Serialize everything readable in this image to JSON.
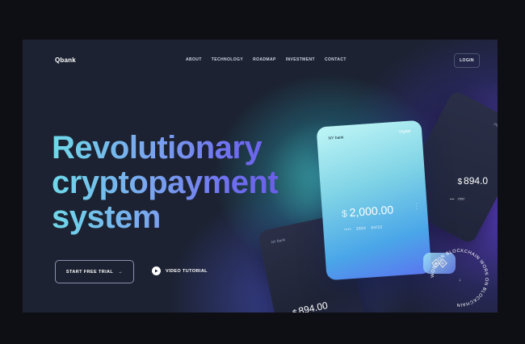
{
  "header": {
    "logo": "Qbank",
    "nav": [
      "ABOUT",
      "TECHNOLOGY",
      "ROADMAP",
      "INVESTMENT",
      "CONTACT"
    ],
    "login_label": "LOGIN"
  },
  "hero": {
    "headline_lines": [
      "Revolutionary",
      "cryptopayment",
      "system"
    ],
    "trial_label": "START FREE TRIAL",
    "trial_arrow": "→",
    "video_label": "VIDEO TUTORIAL"
  },
  "cards": {
    "main": {
      "bank": "NY bank",
      "type": "Digital",
      "currency": "$",
      "amount": "2,000.00",
      "masked": "••••",
      "number": "2552",
      "expiry": "04/22"
    },
    "left": {
      "bank": "NY Bank",
      "currency": "$",
      "amount": "894.00"
    },
    "right": {
      "type": "Physical",
      "currency": "$",
      "amount": "894.0",
      "masked": "••••",
      "number": "2552"
    }
  },
  "badge": {
    "ring_text": "WORK ON BLOCKCHAIN WORK ON BLOCKCHAIN"
  },
  "colors": {
    "background": "#0e0f14",
    "hero": "#1c2231",
    "cyan": "#6fd9e9",
    "violet": "#6a5fe8"
  }
}
